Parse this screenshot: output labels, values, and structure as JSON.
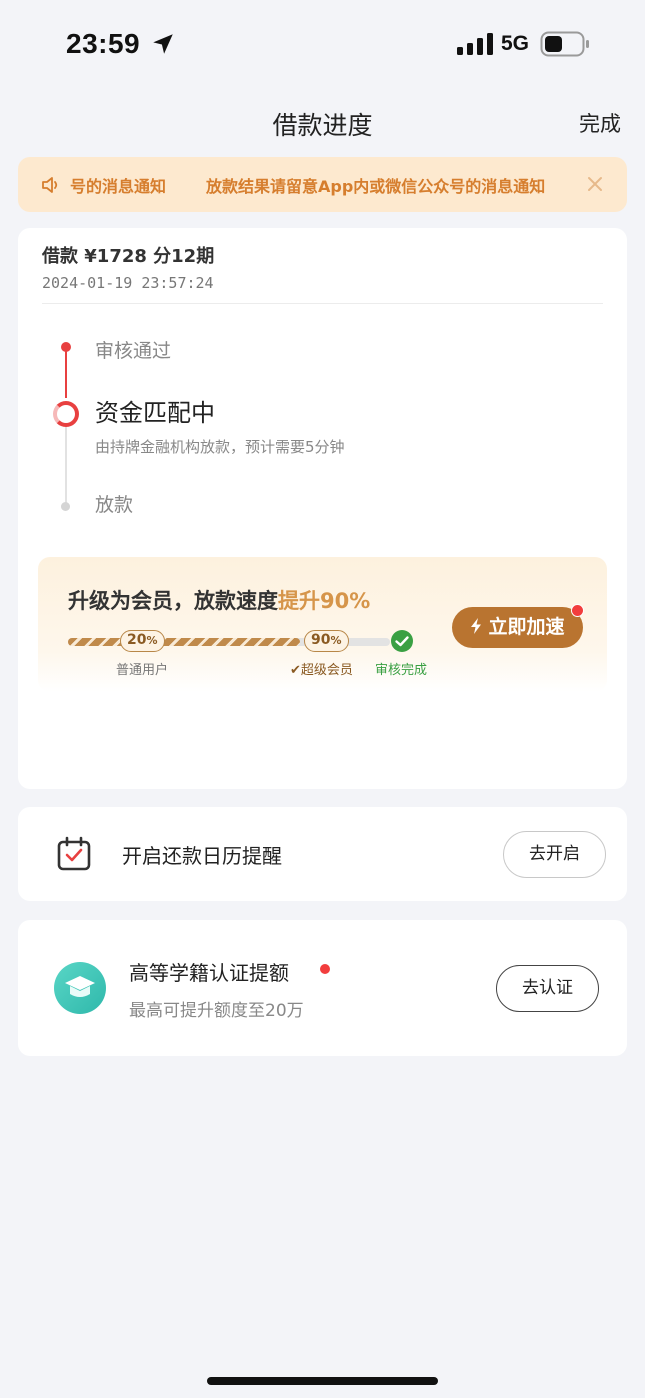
{
  "status_bar": {
    "time": "23:59",
    "network": "5G"
  },
  "nav": {
    "title": "借款进度",
    "done_label": "完成"
  },
  "notice": {
    "text_partial": "号的消息通知",
    "text": "放款结果请留意App内或微信公众号的消息通知"
  },
  "loan": {
    "summary": "借款 ¥1728  分12期",
    "timestamp": "2024-01-19 23:57:24",
    "steps": [
      {
        "label": "审核通过",
        "state": "done"
      },
      {
        "label": "资金匹配中",
        "description": "由持牌金融机构放款，预计需要5分钟",
        "state": "current"
      },
      {
        "label": "放款",
        "state": "pending"
      }
    ]
  },
  "vip": {
    "title_prefix": "升级为会员，放款速度",
    "title_highlight": "提升90%",
    "normal_pct": "20",
    "super_pct": "90",
    "pct_unit": "%",
    "progress_fraction": 0.72,
    "normal_label": "普通用户",
    "super_label": "超级会员",
    "done_label": "审核完成",
    "button_label": "立即加速"
  },
  "calendar": {
    "label": "开启还款日历提醒",
    "button_label": "去开启"
  },
  "education": {
    "title": "高等学籍认证提额",
    "subtitle": "最高可提升额度至20万",
    "button_label": "去认证"
  },
  "colors": {
    "accent_red": "#e84040",
    "gold": "#b97430",
    "notice_text": "#d67e2e",
    "success_green": "#3aa043",
    "teal": "#2fb8ab"
  }
}
